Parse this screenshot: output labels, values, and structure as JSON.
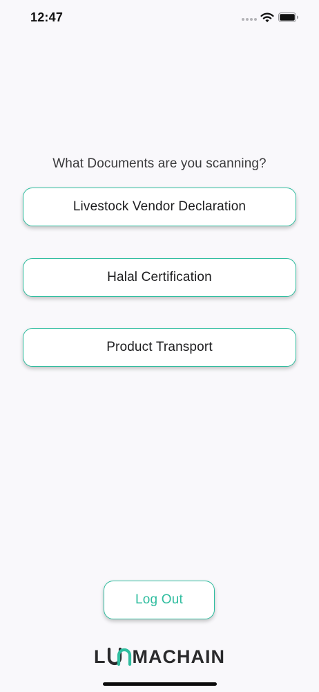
{
  "status_bar": {
    "time": "12:47"
  },
  "main": {
    "prompt": "What Documents are you scanning?",
    "document_options": [
      {
        "label": "Livestock Vendor Declaration"
      },
      {
        "label": "Halal Certification"
      },
      {
        "label": "Product Transport"
      }
    ],
    "logout_label": "Log Out"
  },
  "brand": {
    "logo_text": "LUMACHAIN",
    "accent_color": "#2fbd9f"
  },
  "icons": [
    "signal-dots-icon",
    "wifi-icon",
    "battery-icon"
  ]
}
